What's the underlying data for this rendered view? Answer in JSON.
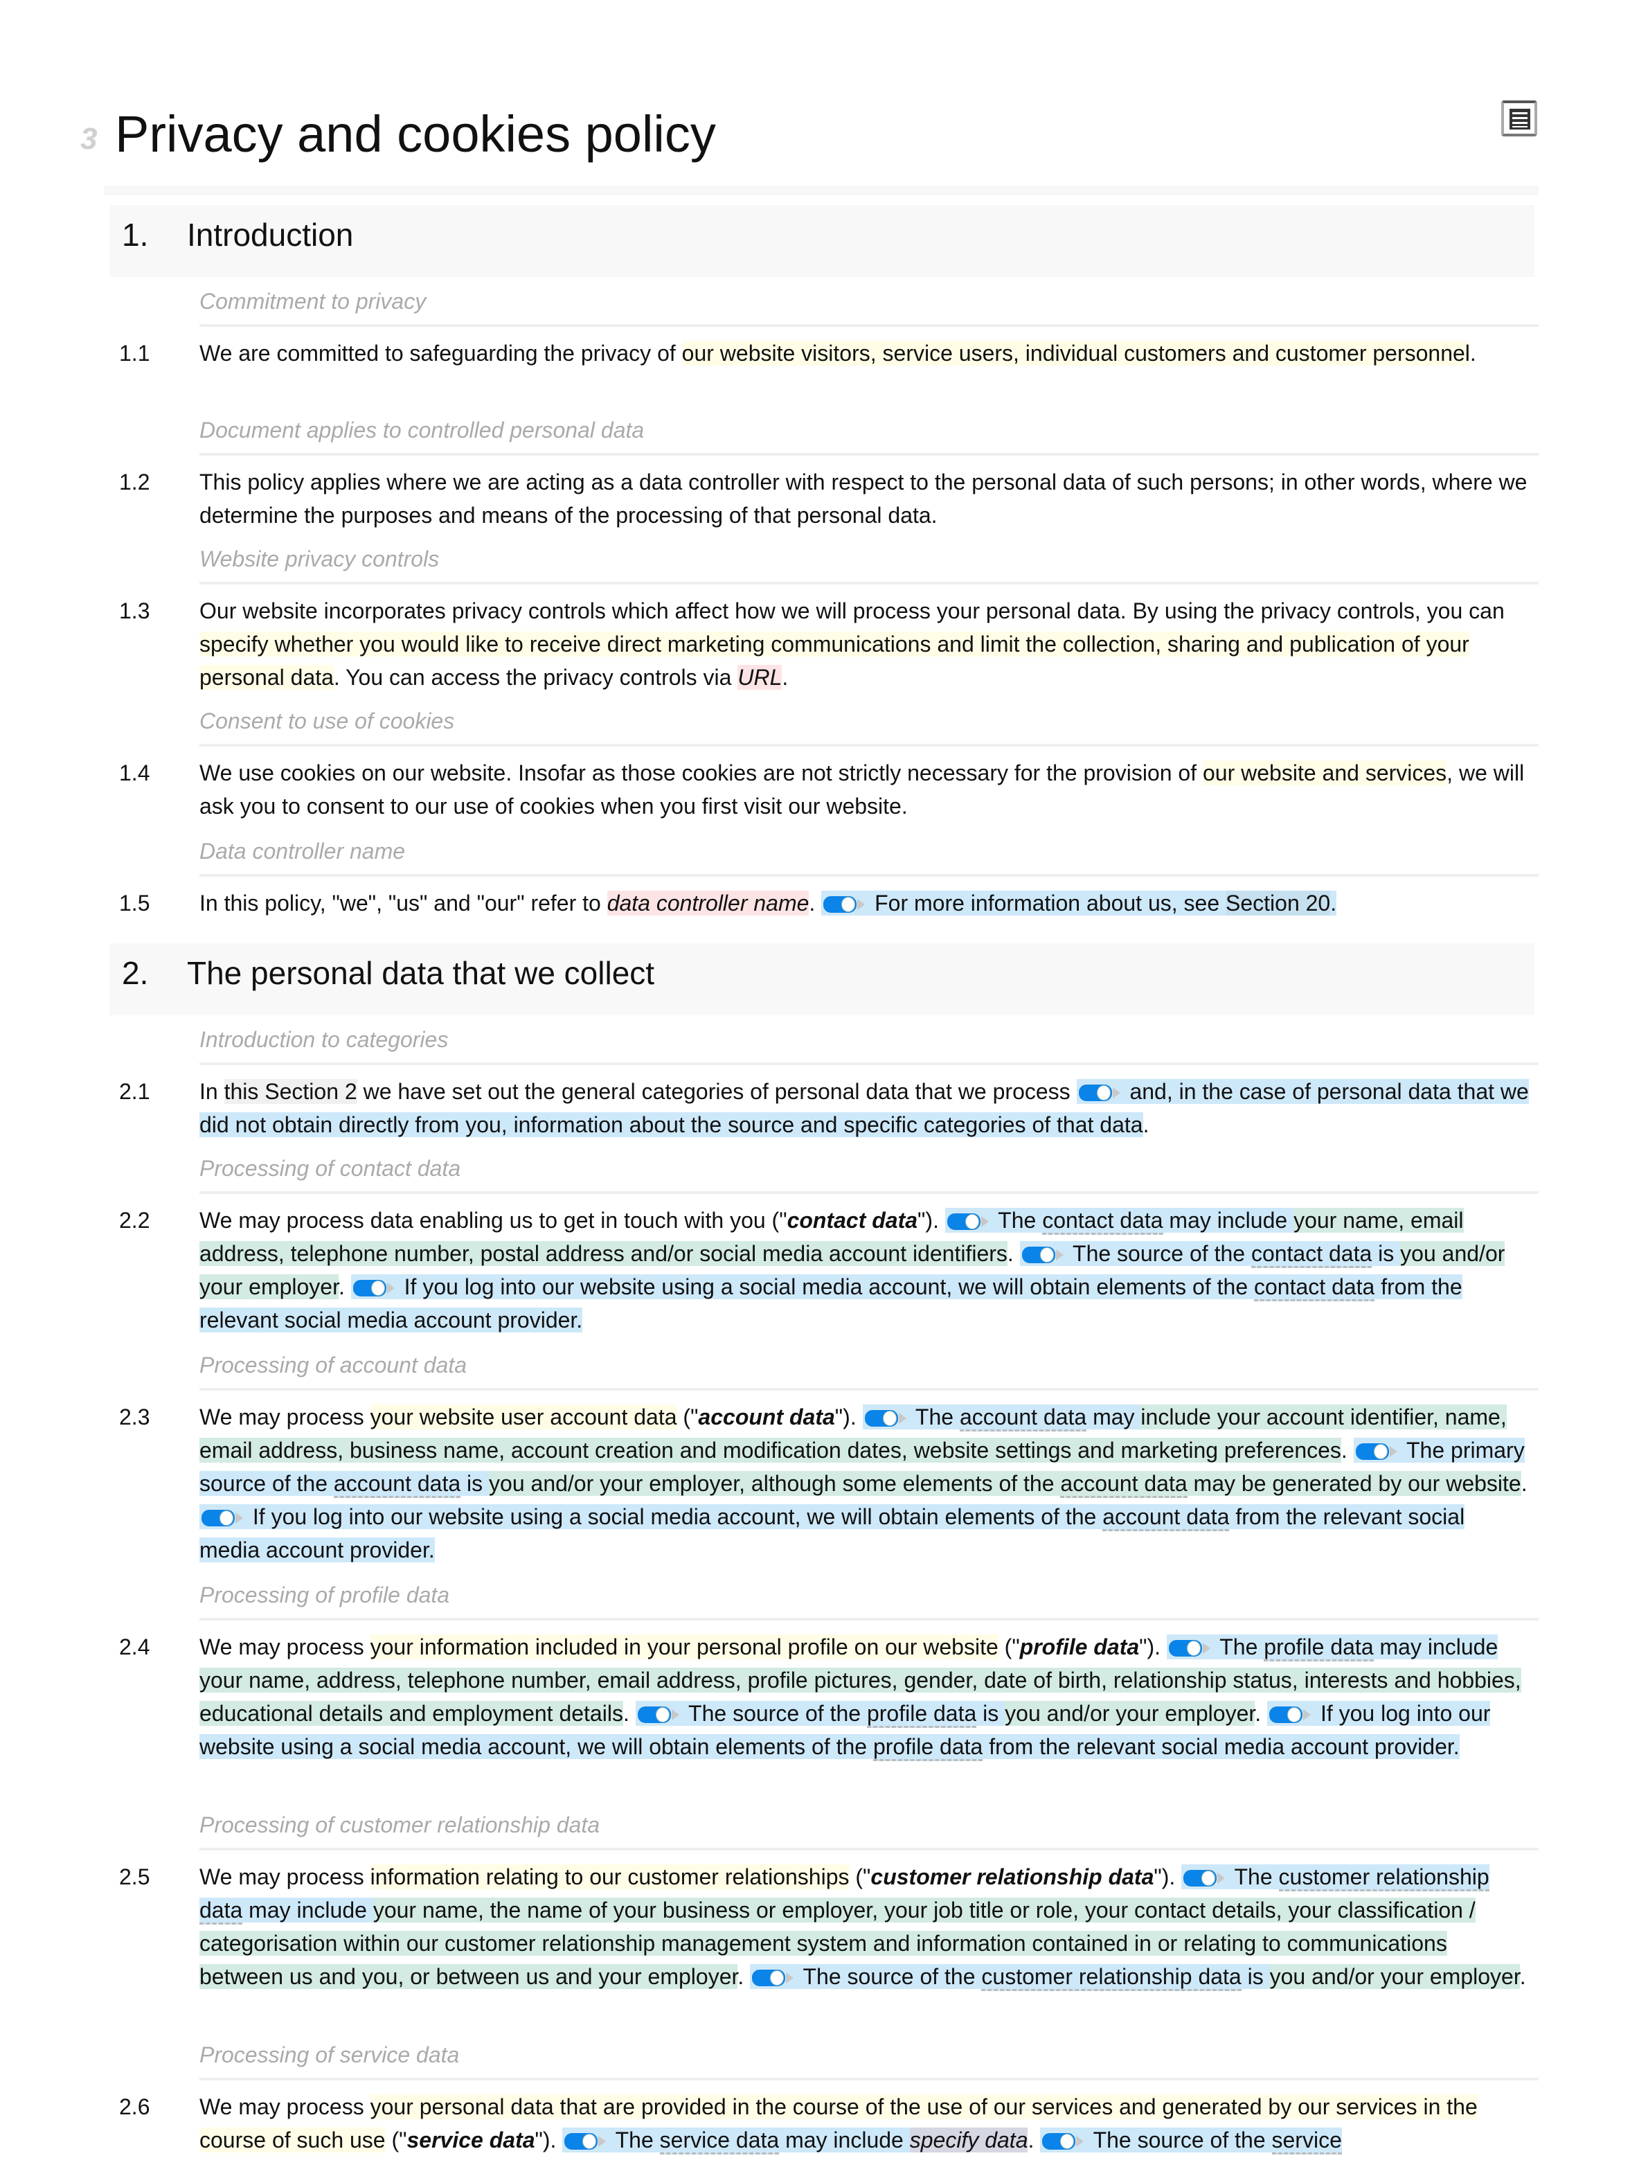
{
  "document": {
    "title": "Privacy and cookies policy",
    "title_glyph": "3",
    "toc_button_icon": "table-of-contents-icon"
  },
  "colors": {
    "highlight_yellow": "#fffde6",
    "highlight_blue": "#cde8f9",
    "highlight_green": "#d3ebe2",
    "highlight_red": "#fde4e4",
    "toggle_blue": "#0a84e8",
    "heading_gray": "#aaaaaa"
  },
  "sections": [
    {
      "number": "1.",
      "title": "Introduction",
      "clauses": [
        {
          "heading": "Commitment to privacy",
          "number": "1.1",
          "segments": [
            {
              "t": "We are committed to safeguarding the privacy of "
            },
            {
              "t": "our website visitors, service users, individual customers and customer personnel",
              "s": "hl-y"
            },
            {
              "t": "."
            }
          ]
        },
        {
          "heading": "Document applies to controlled personal data",
          "number": "1.2",
          "segments": [
            {
              "t": "This policy applies where we are acting as a data controller with respect to the personal data of such persons; in other words, where we determine the purposes and means of the processing of that personal data."
            }
          ]
        },
        {
          "heading": "Website privacy controls",
          "number": "1.3",
          "segments": [
            {
              "t": "Our website incorporates privacy controls which affect how we will process your personal data. By using the privacy controls, you can "
            },
            {
              "t": "specify whether you would like to receive direct marketing communications and limit the collection, sharing and publication of your personal data",
              "s": "hl-y"
            },
            {
              "t": ". You can access the privacy controls via "
            },
            {
              "t": "URL",
              "s": "hl-r"
            },
            {
              "t": "."
            }
          ]
        },
        {
          "heading": "Consent to use of cookies",
          "number": "1.4",
          "segments": [
            {
              "t": "We use cookies on our website. Insofar as those cookies are not strictly necessary for the provision of "
            },
            {
              "t": "our website and services",
              "s": "hl-y"
            },
            {
              "t": ", we will ask you to consent to our use of cookies when you first visit our website."
            }
          ]
        },
        {
          "heading": "Data controller name",
          "number": "1.5",
          "segments": [
            {
              "t": "In this policy, \"we\", \"us\" and \"our\" refer to "
            },
            {
              "t": "data controller name",
              "s": "hl-r"
            },
            {
              "t": ". "
            },
            {
              "toggle": true
            },
            {
              "t": " For more information about us, see ",
              "s": "hl-b"
            },
            {
              "t": "Section 20",
              "s": "hl-gray-b"
            },
            {
              "t": ".",
              "s": "hl-b"
            }
          ]
        }
      ]
    },
    {
      "number": "2.",
      "title": "The personal data that we collect",
      "clauses": [
        {
          "heading": "Introduction to categories",
          "number": "2.1",
          "segments": [
            {
              "t": "In "
            },
            {
              "t": "this Section 2",
              "s": "hl-gray"
            },
            {
              "t": " we have set out the general categories of personal data that we process "
            },
            {
              "toggle": true
            },
            {
              "t": " and, in the case of personal data that we did not obtain directly from you, information about the source and specific categories of that data",
              "s": "hl-b"
            },
            {
              "t": "."
            }
          ]
        },
        {
          "heading": "Processing of contact data",
          "number": "2.2",
          "segments": [
            {
              "t": "We may process data enabling us to get in touch with you (\""
            },
            {
              "t": "contact data",
              "s": "def"
            },
            {
              "t": "\"). "
            },
            {
              "toggle": true
            },
            {
              "t": " The ",
              "s": "hl-b"
            },
            {
              "t": "contact data",
              "s": "hl-b term"
            },
            {
              "t": " may include ",
              "s": "hl-b"
            },
            {
              "t": "your name, email address, telephone number, postal address and/or social media account identifiers",
              "s": "hl-g"
            },
            {
              "t": ". "
            },
            {
              "toggle": true
            },
            {
              "t": " The source of the ",
              "s": "hl-b"
            },
            {
              "t": "contact data",
              "s": "hl-b term"
            },
            {
              "t": " is ",
              "s": "hl-b"
            },
            {
              "t": "you and/or your employer",
              "s": "hl-g"
            },
            {
              "t": ". "
            },
            {
              "toggle": true
            },
            {
              "t": " If you log into our website using a social media account, we will obtain elements of the ",
              "s": "hl-b"
            },
            {
              "t": "contact data",
              "s": "hl-b term"
            },
            {
              "t": " from the relevant social media account provider.",
              "s": "hl-b"
            }
          ]
        },
        {
          "heading": "Processing of account data",
          "number": "2.3",
          "segments": [
            {
              "t": "We may process "
            },
            {
              "t": "your website user account data",
              "s": "hl-y"
            },
            {
              "t": " (\""
            },
            {
              "t": "account data",
              "s": "def"
            },
            {
              "t": "\"). "
            },
            {
              "toggle": true
            },
            {
              "t": " The ",
              "s": "hl-b"
            },
            {
              "t": "account data",
              "s": "hl-b term"
            },
            {
              "t": " may ",
              "s": "hl-b"
            },
            {
              "t": "include your account identifier, name, email address, business name, account creation and modification dates, website settings and marketing preferences",
              "s": "hl-g"
            },
            {
              "t": ". "
            },
            {
              "toggle": true
            },
            {
              "t": " The primary source of the ",
              "s": "hl-b"
            },
            {
              "t": "account data",
              "s": "hl-b term"
            },
            {
              "t": " is ",
              "s": "hl-b"
            },
            {
              "t": "you and/or your employer, although some elements of the ",
              "s": "hl-g"
            },
            {
              "t": "account data",
              "s": "hl-g term"
            },
            {
              "t": " may be generated by our website",
              "s": "hl-g"
            },
            {
              "t": ". "
            },
            {
              "toggle": true
            },
            {
              "t": " If you log into our website using a social media account, we will obtain elements of the ",
              "s": "hl-b"
            },
            {
              "t": "account data",
              "s": "hl-b term"
            },
            {
              "t": " from the relevant social media account provider.",
              "s": "hl-b"
            }
          ]
        },
        {
          "heading": "Processing of profile data",
          "number": "2.4",
          "segments": [
            {
              "t": "We may process "
            },
            {
              "t": "your information included in your personal profile on our website",
              "s": "hl-y"
            },
            {
              "t": " (\""
            },
            {
              "t": "profile data",
              "s": "def"
            },
            {
              "t": "\"). "
            },
            {
              "toggle": true
            },
            {
              "t": " The ",
              "s": "hl-b"
            },
            {
              "t": "profile data",
              "s": "hl-b term"
            },
            {
              "t": " may include ",
              "s": "hl-b"
            },
            {
              "t": "your name, address, telephone number, email address, profile pictures, gender, date of birth, relationship status, interests and hobbies, educational details and employment details",
              "s": "hl-g"
            },
            {
              "t": ". "
            },
            {
              "toggle": true
            },
            {
              "t": " The source of the ",
              "s": "hl-b"
            },
            {
              "t": "profile data",
              "s": "hl-b term"
            },
            {
              "t": " is ",
              "s": "hl-b"
            },
            {
              "t": "you and/or your employer",
              "s": "hl-g"
            },
            {
              "t": ". "
            },
            {
              "toggle": true
            },
            {
              "t": " If you log into our website using a social media account, we will obtain elements of the ",
              "s": "hl-b"
            },
            {
              "t": "profile data",
              "s": "hl-b term"
            },
            {
              "t": " from the relevant social media account provider.",
              "s": "hl-b"
            }
          ]
        },
        {
          "heading": "Processing of customer relationship data",
          "number": "2.5",
          "segments": [
            {
              "t": "We may process "
            },
            {
              "t": "information relating to our customer relationships",
              "s": "hl-y"
            },
            {
              "t": " (\""
            },
            {
              "t": "customer relationship data",
              "s": "def"
            },
            {
              "t": "\"). "
            },
            {
              "toggle": true
            },
            {
              "t": " The ",
              "s": "hl-b"
            },
            {
              "t": "customer relationship data",
              "s": "hl-b term"
            },
            {
              "t": " may include ",
              "s": "hl-b"
            },
            {
              "t": "your name, the name of your business or employer, your job title or role, your contact details, your classification / categorisation within our customer relationship management system and information contained in or relating to communications between us and you, or between us and your employer",
              "s": "hl-g"
            },
            {
              "t": ". "
            },
            {
              "toggle": true
            },
            {
              "t": " The source of the ",
              "s": "hl-b"
            },
            {
              "t": "customer relationship data",
              "s": "hl-b term"
            },
            {
              "t": " is ",
              "s": "hl-b"
            },
            {
              "t": "you and/or your employer",
              "s": "hl-g"
            },
            {
              "t": "."
            }
          ]
        },
        {
          "heading": "Processing of service data",
          "number": "2.6",
          "segments": [
            {
              "t": "We may process "
            },
            {
              "t": "your personal data that are provided in the course of the use of our services and generated by our services in the course of such use",
              "s": "hl-y"
            },
            {
              "t": " (\""
            },
            {
              "t": "service data",
              "s": "def"
            },
            {
              "t": "\"). "
            },
            {
              "toggle": true
            },
            {
              "t": " The ",
              "s": "hl-b"
            },
            {
              "t": "service data",
              "s": "hl-b term"
            },
            {
              "t": " may include ",
              "s": "hl-b"
            },
            {
              "t": "specify data",
              "s": "hl-spec"
            },
            {
              "t": ". "
            },
            {
              "toggle": true
            },
            {
              "t": " The source of the ",
              "s": "hl-b"
            },
            {
              "t": "service",
              "s": "hl-b term"
            }
          ]
        }
      ]
    }
  ]
}
